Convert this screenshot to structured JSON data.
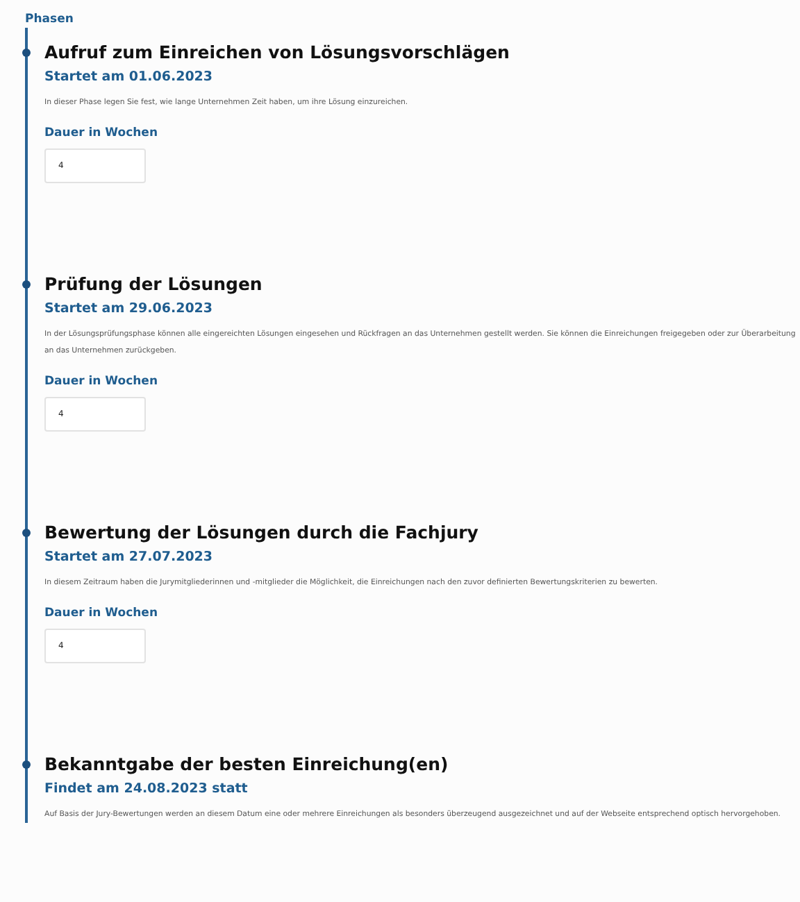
{
  "section_title": "Phasen",
  "phases": [
    {
      "title": "Aufruf zum Einreichen von Lösungsvorschlägen",
      "date": "Startet am 01.06.2023",
      "description": "In dieser Phase legen Sie fest, wie lange Unternehmen Zeit haben, um ihre Lösung einzureichen.",
      "field": {
        "label": "Dauer in Wochen",
        "value": "4"
      }
    },
    {
      "title": "Prüfung der Lösungen",
      "date": "Startet am 29.06.2023",
      "description": "In der Lösungsprüfungsphase können alle eingereichten Lösungen eingesehen und Rückfragen an das Unternehmen gestellt werden. Sie können die Einreichungen freigegeben oder zur Überarbeitung an das Unternehmen zurückgeben.",
      "field": {
        "label": "Dauer in Wochen",
        "value": "4"
      }
    },
    {
      "title": "Bewertung der Lösungen durch die Fachjury",
      "date": "Startet am 27.07.2023",
      "description": "In diesem Zeitraum haben die Jurymitgliederinnen und -mitglieder die Möglichkeit, die Einreichungen nach den zuvor definierten Bewertungskriterien zu bewerten.",
      "field": {
        "label": "Dauer in Wochen",
        "value": "4"
      }
    },
    {
      "title": "Bekanntgabe der besten Einreichung(en)",
      "date": "Findet am 24.08.2023 statt",
      "description": "Auf Basis der Jury-Bewertungen werden an diesem Datum eine oder mehrere Einreichungen als besonders überzeugend ausgezeichnet und auf der Webseite entsprechend optisch hervorgehoben."
    }
  ]
}
